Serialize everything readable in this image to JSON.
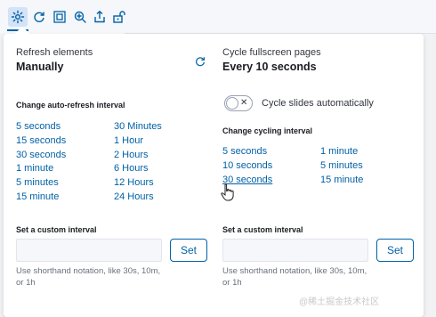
{
  "toolbar": {
    "icons": [
      "gear-icon",
      "refresh-icon",
      "fullscreen-icon",
      "zoom-in-icon",
      "share-icon",
      "lock-open-icon"
    ]
  },
  "refresh": {
    "label": "Refresh elements",
    "value": "Manually",
    "interval_title": "Change auto-refresh interval",
    "intervals_col1": [
      "5 seconds",
      "15 seconds",
      "30 seconds",
      "1 minute",
      "5 minutes",
      "15 minute"
    ],
    "intervals_col2": [
      "30 Minutes",
      "1 Hour",
      "2 Hours",
      "6 Hours",
      "12 Hours",
      "24 Hours"
    ],
    "custom_title": "Set a custom interval",
    "input_value": "",
    "set_label": "Set",
    "help": "Use shorthand notation, like 30s, 10m, or 1h"
  },
  "cycle": {
    "label": "Cycle fullscreen pages",
    "value": "Every 10 seconds",
    "toggle_label": "Cycle slides automatically",
    "toggle_on": false,
    "interval_title": "Change cycling interval",
    "intervals_col1": [
      "5 seconds",
      "10 seconds",
      "30 seconds"
    ],
    "intervals_col2": [
      "1 minute",
      "5 minutes",
      "15 minute"
    ],
    "custom_title": "Set a custom interval",
    "input_value": "",
    "set_label": "Set",
    "help": "Use shorthand notation, like 30s, 10m, or 1h"
  },
  "watermark": "@稀土掘金技术社区",
  "colors": {
    "link": "#0061a6",
    "accent_bg": "#d3e3f8",
    "panel": "#ffffff",
    "text": "#343741"
  }
}
